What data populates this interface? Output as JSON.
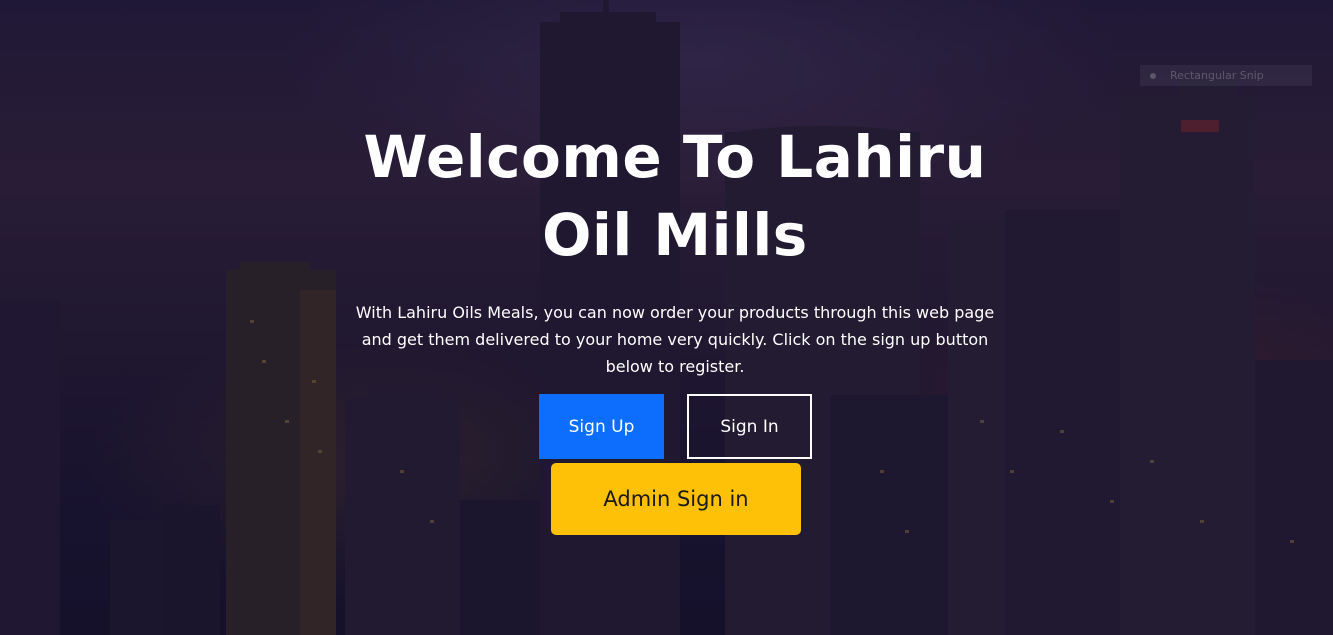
{
  "hero": {
    "title": "Welcome To Lahiru Oil Mills",
    "description": "With Lahiru Oils Meals, you can now order your products through this web page and get them delivered to your home very quickly. Click on the sign up button below to register."
  },
  "buttons": {
    "sign_up": "Sign Up",
    "sign_in": "Sign In",
    "admin_sign_in": "Admin Sign in"
  },
  "snip_overlay": {
    "label": "Rectangular Snip"
  },
  "colors": {
    "primary": "#0d6efd",
    "warning": "#ffc107",
    "overlay": "#140e2d"
  }
}
